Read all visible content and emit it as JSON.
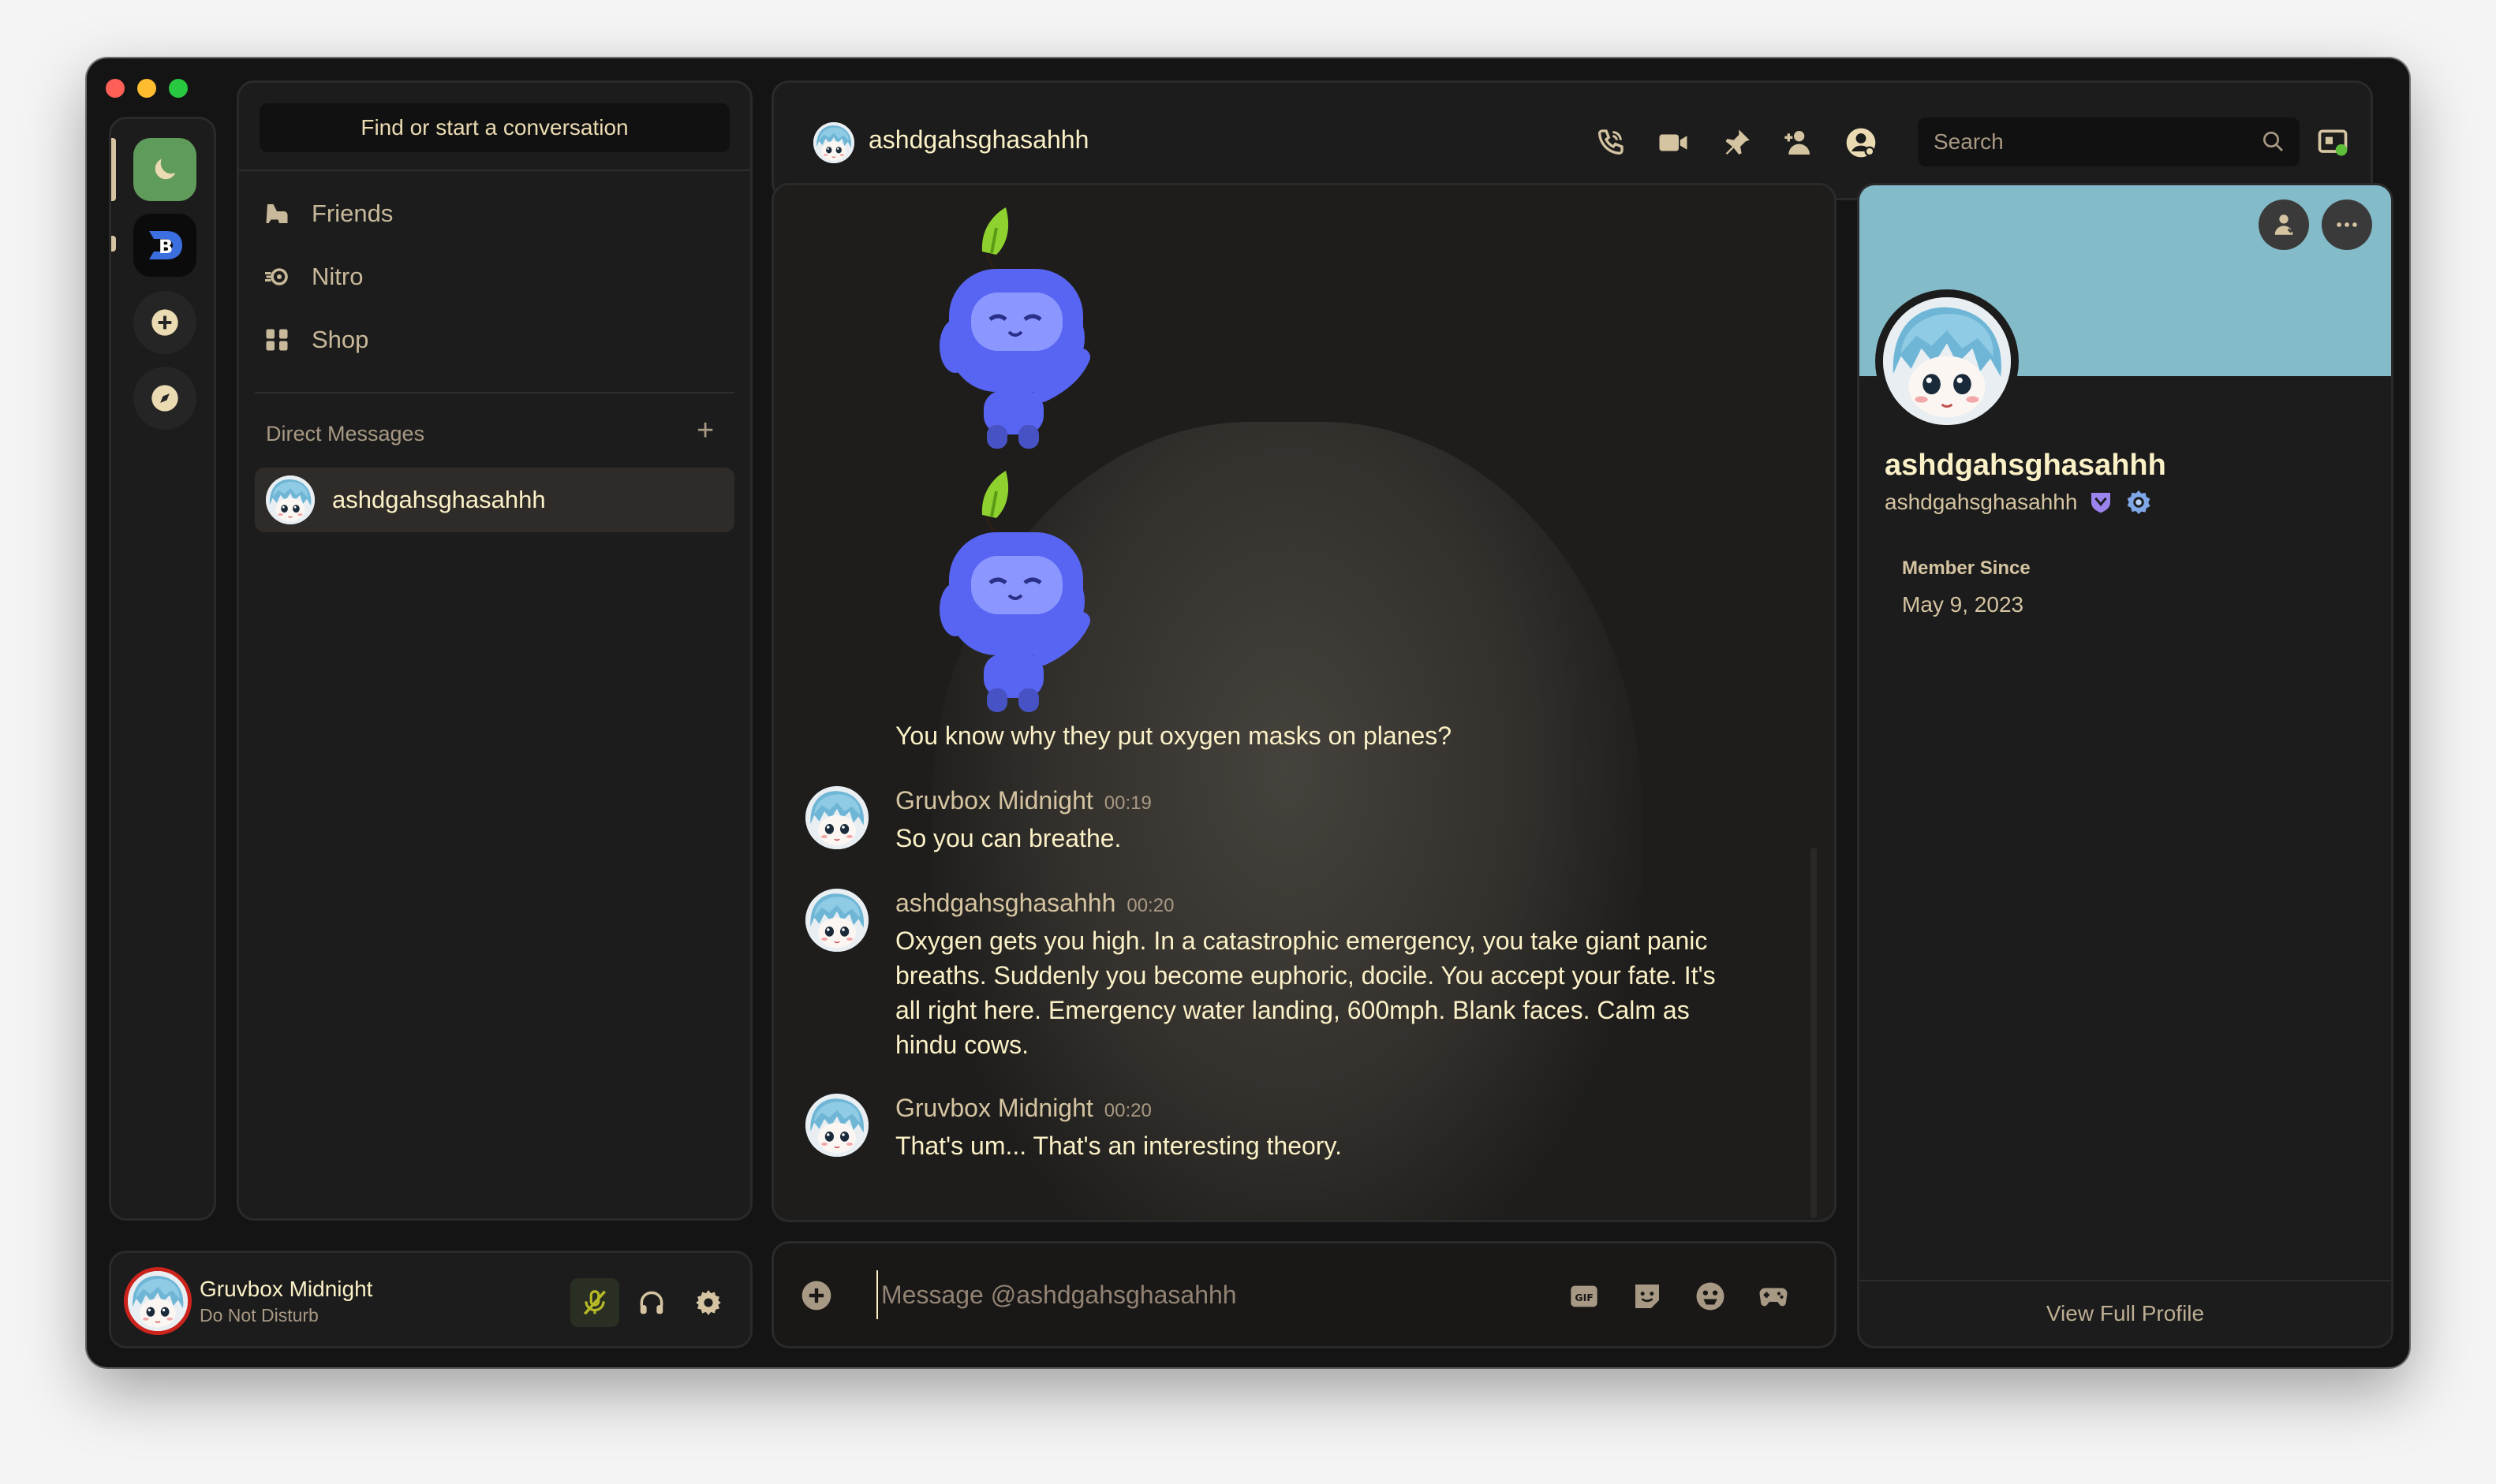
{
  "window": {
    "controls": [
      "close",
      "minimize",
      "maximize"
    ]
  },
  "rail": {
    "items": [
      {
        "name": "home",
        "icon": "moon-icon",
        "color": "#5f9b5a"
      },
      {
        "name": "server",
        "icon": "server-logo-icon"
      },
      {
        "name": "add-server",
        "icon": "plus-circle-icon"
      },
      {
        "name": "explore",
        "icon": "compass-icon"
      }
    ]
  },
  "dm_panel": {
    "find_label": "Find or start a conversation",
    "nav": [
      {
        "label": "Friends",
        "icon": "friends-icon"
      },
      {
        "label": "Nitro",
        "icon": "nitro-icon"
      },
      {
        "label": "Shop",
        "icon": "shop-icon"
      }
    ],
    "direct_messages_label": "Direct Messages",
    "add_dm_symbol": "+",
    "dms": [
      {
        "name": "ashdgahsghasahhh"
      }
    ]
  },
  "user_panel": {
    "name": "Gruvbox Midnight",
    "status": "Do Not Disturb",
    "status_color": "#cc241d"
  },
  "header": {
    "channel_name": "ashdgahsghasahhh",
    "icons": [
      "phone-icon",
      "video-icon",
      "pin-icon",
      "add-friend-icon",
      "profile-icon"
    ],
    "search_placeholder": "Search"
  },
  "chat": {
    "stickers": [
      "wumpus-sticker",
      "wumpus-sticker"
    ],
    "continuation_text": "You know why they put oxygen masks on planes?",
    "messages": [
      {
        "author": "Gruvbox Midnight",
        "time": "00:19",
        "text": "So you can breathe."
      },
      {
        "author": "ashdgahsghasahhh",
        "time": "00:20",
        "text": "Oxygen gets you high. In a catastrophic emergency, you take giant panic breaths. Suddenly you become euphoric, docile. You accept your fate. It's all right here. Emergency water landing, 600mph. Blank faces. Calm as hindu cows."
      },
      {
        "author": "Gruvbox Midnight",
        "time": "00:20",
        "text": "That's um... That's an interesting theory."
      }
    ]
  },
  "composer": {
    "placeholder": "Message @ashdgahsghasahhh",
    "icons": [
      "gif-icon",
      "sticker-icon",
      "emoji-icon",
      "gamepad-icon"
    ]
  },
  "profile": {
    "banner_color": "#84bbc9",
    "display_name": "ashdgahsghasahhh",
    "username": "ashdgahsghasahhh",
    "badges": [
      "hypesquad-badge-icon",
      "nitro-badge-icon"
    ],
    "member_since_label": "Member Since",
    "member_since_date": "May 9, 2023",
    "view_full_label": "View Full Profile"
  }
}
